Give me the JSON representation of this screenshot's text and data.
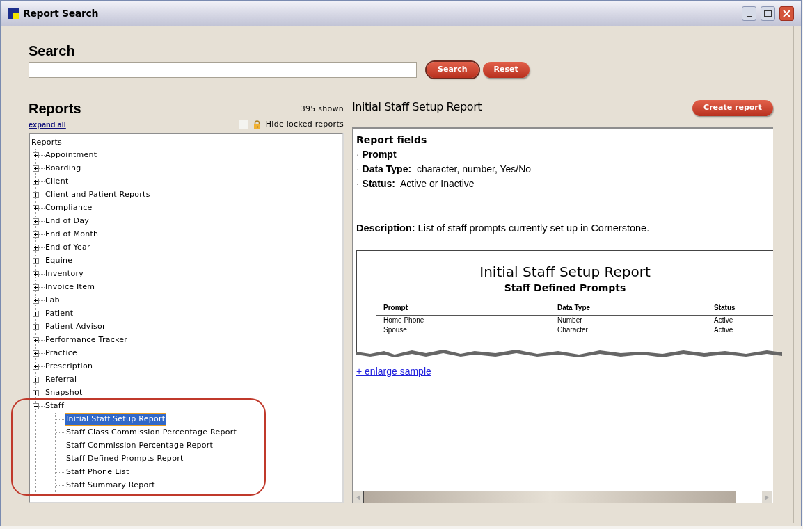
{
  "window": {
    "title": "Report Search"
  },
  "search": {
    "heading": "Search",
    "buttons": [
      {
        "label": "Search",
        "focused": true
      },
      {
        "label": "Reset",
        "focused": false
      }
    ]
  },
  "reports": {
    "heading": "Reports",
    "count": "395 shown",
    "expand_link": "expand all",
    "hide_locked": {
      "label": "Hide locked reports",
      "checked": false
    },
    "tree": {
      "root": "Reports",
      "children": [
        {
          "label": "Appointment",
          "expanded": false
        },
        {
          "label": "Boarding",
          "expanded": false
        },
        {
          "label": "Client",
          "expanded": false
        },
        {
          "label": "Client and Patient Reports",
          "expanded": false
        },
        {
          "label": "Compliance",
          "expanded": false
        },
        {
          "label": "End of Day",
          "expanded": false
        },
        {
          "label": "End of Month",
          "expanded": false
        },
        {
          "label": "End of Year",
          "expanded": false
        },
        {
          "label": "Equine",
          "expanded": false
        },
        {
          "label": "Inventory",
          "expanded": false
        },
        {
          "label": "Invoice Item",
          "expanded": false
        },
        {
          "label": "Lab",
          "expanded": false
        },
        {
          "label": "Patient",
          "expanded": false
        },
        {
          "label": "Patient Advisor",
          "expanded": false
        },
        {
          "label": "Performance Tracker",
          "expanded": false
        },
        {
          "label": "Practice",
          "expanded": false
        },
        {
          "label": "Prescription",
          "expanded": false
        },
        {
          "label": "Referral",
          "expanded": false
        },
        {
          "label": "Snapshot",
          "expanded": false
        },
        {
          "label": "Staff",
          "expanded": true,
          "children": [
            {
              "label": "Initial Staff Setup Report",
              "selected": true
            },
            {
              "label": "Staff Class Commission Percentage Report",
              "selected": false
            },
            {
              "label": "Staff Commission Percentage Report",
              "selected": false
            },
            {
              "label": "Staff Defined Prompts Report",
              "selected": false
            },
            {
              "label": "Staff Phone List",
              "selected": false
            },
            {
              "label": "Staff Summary Report",
              "selected": false
            }
          ]
        }
      ]
    }
  },
  "detail": {
    "title": "Initial Staff Setup Report",
    "create_button": "Create report",
    "fields_heading": "Report fields",
    "fields": [
      "· **Prompt**",
      "· **Data Type:**  character, number, Yes/No",
      "· **Status:**  Active or Inactive"
    ],
    "description": "**Description:** List of staff prompts currently set up in Cornerstone.",
    "sample": {
      "title": "Initial Staff Setup Report",
      "subtitle": "Staff Defined Prompts",
      "columns": [
        "Prompt",
        "Data Type",
        "Status"
      ],
      "rows": [
        [
          "Home Phone",
          "Number",
          "Active"
        ],
        [
          "Spouse",
          "Character",
          "Active"
        ]
      ]
    },
    "enlarge_link": "+ enlarge sample"
  }
}
